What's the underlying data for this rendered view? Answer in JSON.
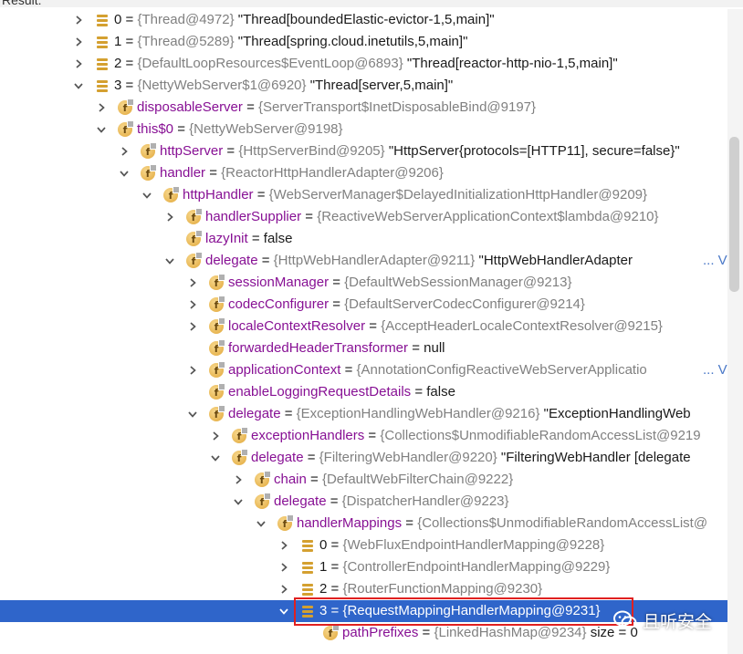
{
  "header": {
    "label": "Result:"
  },
  "colors": {
    "field_name": "#871094",
    "type_hint": "#808080",
    "selection": "#2f65ca",
    "highlight_box": "#e02020",
    "view_link": "#4b79c8"
  },
  "rows": [
    {
      "depth": 0,
      "arrow": "right",
      "icon": "array",
      "name": "0",
      "type": "{Thread@4972}",
      "value": "\"Thread[boundedElastic-evictor-1,5,main]\""
    },
    {
      "depth": 0,
      "arrow": "right",
      "icon": "array",
      "name": "1",
      "type": "{Thread@5289}",
      "value": "\"Thread[spring.cloud.inetutils,5,main]\""
    },
    {
      "depth": 0,
      "arrow": "right",
      "icon": "array",
      "name": "2",
      "type": "{DefaultLoopResources$EventLoop@6893}",
      "value": "\"Thread[reactor-http-nio-1,5,main]\""
    },
    {
      "depth": 0,
      "arrow": "down",
      "icon": "array",
      "name": "3",
      "type": "{NettyWebServer$1@6920}",
      "value": "\"Thread[server,5,main]\""
    },
    {
      "depth": 1,
      "arrow": "right",
      "icon": "field",
      "name": "disposableServer",
      "type": "{ServerTransport$InetDisposableBind@9197}",
      "value": ""
    },
    {
      "depth": 1,
      "arrow": "down",
      "icon": "field",
      "name": "this$0",
      "type": "{NettyWebServer@9198}",
      "value": ""
    },
    {
      "depth": 2,
      "arrow": "right",
      "icon": "field",
      "name": "httpServer",
      "type": "{HttpServerBind@9205}",
      "value": "\"HttpServer{protocols=[HTTP11], secure=false}\""
    },
    {
      "depth": 2,
      "arrow": "down",
      "icon": "field",
      "name": "handler",
      "type": "{ReactorHttpHandlerAdapter@9206}",
      "value": ""
    },
    {
      "depth": 3,
      "arrow": "down",
      "icon": "field",
      "name": "httpHandler",
      "type": "{WebServerManager$DelayedInitializationHttpHandler@9209}",
      "value": ""
    },
    {
      "depth": 4,
      "arrow": "right",
      "icon": "field",
      "name": "handlerSupplier",
      "type": "{ReactiveWebServerApplicationContext$lambda@9210}",
      "value": ""
    },
    {
      "depth": 4,
      "arrow": "none",
      "icon": "field",
      "name": "lazyInit",
      "type": "",
      "value": "false"
    },
    {
      "depth": 4,
      "arrow": "down",
      "icon": "field",
      "name": "delegate",
      "type": "{HttpWebHandlerAdapter@9211}",
      "value": "\"HttpWebHandlerAdapter",
      "view": "... View"
    },
    {
      "depth": 5,
      "arrow": "right",
      "icon": "field",
      "name": "sessionManager",
      "type": "{DefaultWebSessionManager@9213}",
      "value": ""
    },
    {
      "depth": 5,
      "arrow": "right",
      "icon": "field",
      "name": "codecConfigurer",
      "type": "{DefaultServerCodecConfigurer@9214}",
      "value": ""
    },
    {
      "depth": 5,
      "arrow": "right",
      "icon": "field",
      "name": "localeContextResolver",
      "type": "{AcceptHeaderLocaleContextResolver@9215}",
      "value": ""
    },
    {
      "depth": 5,
      "arrow": "none",
      "icon": "field",
      "name": "forwardedHeaderTransformer",
      "type": "",
      "value": "null"
    },
    {
      "depth": 5,
      "arrow": "right",
      "icon": "field",
      "name": "applicationContext",
      "type": "{AnnotationConfigReactiveWebServerApplicatio",
      "value": "",
      "view": "... View"
    },
    {
      "depth": 5,
      "arrow": "none",
      "icon": "field",
      "name": "enableLoggingRequestDetails",
      "type": "",
      "value": "false"
    },
    {
      "depth": 5,
      "arrow": "down",
      "icon": "field",
      "name": "delegate",
      "type": "{ExceptionHandlingWebHandler@9216}",
      "value": "\"ExceptionHandlingWeb"
    },
    {
      "depth": 6,
      "arrow": "right",
      "icon": "field",
      "name": "exceptionHandlers",
      "type": "{Collections$UnmodifiableRandomAccessList@9219",
      "value": ""
    },
    {
      "depth": 6,
      "arrow": "down",
      "icon": "field",
      "name": "delegate",
      "type": "{FilteringWebHandler@9220}",
      "value": "\"FilteringWebHandler [delegate"
    },
    {
      "depth": 7,
      "arrow": "right",
      "icon": "field",
      "name": "chain",
      "type": "{DefaultWebFilterChain@9222}",
      "value": ""
    },
    {
      "depth": 7,
      "arrow": "down",
      "icon": "field",
      "name": "delegate",
      "type": "{DispatcherHandler@9223}",
      "value": ""
    },
    {
      "depth": 8,
      "arrow": "down",
      "icon": "field",
      "name": "handlerMappings",
      "type": "{Collections$UnmodifiableRandomAccessList@",
      "value": ""
    },
    {
      "depth": 9,
      "arrow": "right",
      "icon": "array",
      "name": "0",
      "type": "{WebFluxEndpointHandlerMapping@9228}",
      "value": ""
    },
    {
      "depth": 9,
      "arrow": "right",
      "icon": "array",
      "name": "1",
      "type": "{ControllerEndpointHandlerMapping@9229}",
      "value": ""
    },
    {
      "depth": 9,
      "arrow": "right",
      "icon": "array",
      "name": "2",
      "type": "{RouterFunctionMapping@9230}",
      "value": ""
    },
    {
      "depth": 9,
      "arrow": "down",
      "icon": "array",
      "name": "3",
      "type": "{RequestMappingHandlerMapping@9231}",
      "value": "",
      "selected": true
    },
    {
      "depth": 10,
      "arrow": "none",
      "icon": "field",
      "name": "pathPrefixes",
      "type": "{LinkedHashMap@9234}",
      "value": "size = 0"
    }
  ],
  "watermark": {
    "text": "且听安全",
    "icon": "wechat-icon"
  }
}
